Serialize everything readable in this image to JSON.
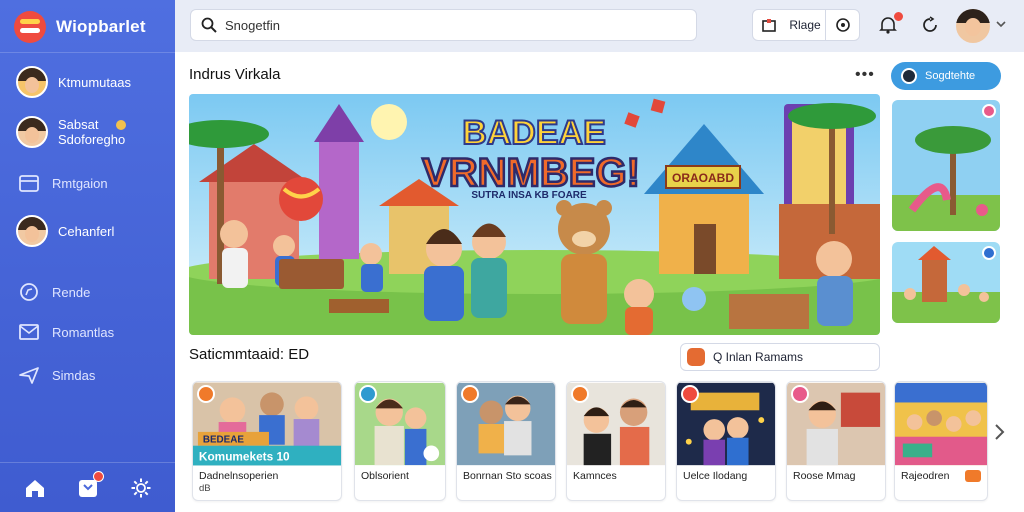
{
  "brand": {
    "name": "Wiopbarlet"
  },
  "sidebar": {
    "items": [
      {
        "label": "Ktmumutaas"
      },
      {
        "label_line1": "Sabsat",
        "label_line2": "Sdoforegho"
      },
      {
        "label": "Rmtgaion"
      },
      {
        "label": "Cehanferl"
      },
      {
        "label": "Rende"
      },
      {
        "label": "Romantlas"
      },
      {
        "label": "Simdas"
      }
    ]
  },
  "topbar": {
    "search_value": "Snogetfin",
    "page_label": "Rlage"
  },
  "main": {
    "section_title": "Indrus Virkala",
    "action_button": "Sogdtehte",
    "row_title": "Saticmmtaaid: ED",
    "filter_label": "Q Inlan Ramams"
  },
  "hero": {
    "title_line1": "BADEAE",
    "title_line2": "VRNMBEG!",
    "subtitle": "SUTRA INSA KB FOARE",
    "sign": "ORAOABD"
  },
  "cards": [
    {
      "label": "Dadnelnsoperien",
      "sub": "dB",
      "banner": "Komumekets 10",
      "banner_top": "BEDEAE"
    },
    {
      "label": "Oblsorient",
      "sub": ""
    },
    {
      "label": "Bonrnan Sto scoas",
      "sub": ""
    },
    {
      "label": "Kamnces",
      "sub": ""
    },
    {
      "label": "Uelce Ilodang",
      "sub": ""
    },
    {
      "label": "Roose Mmag",
      "sub": ""
    },
    {
      "label": "Rajeodren",
      "sub": ""
    }
  ],
  "colors": {
    "sidebar": "#4a68db",
    "accent": "#3d9be0",
    "badge_orange": "#f07a2a",
    "badge_red": "#ef4b3f"
  },
  "icons": [
    "search-icon",
    "store-icon",
    "target-icon",
    "bell-icon",
    "refresh-icon",
    "home-icon",
    "inbox-icon",
    "settings-icon",
    "chevron-right-icon"
  ]
}
